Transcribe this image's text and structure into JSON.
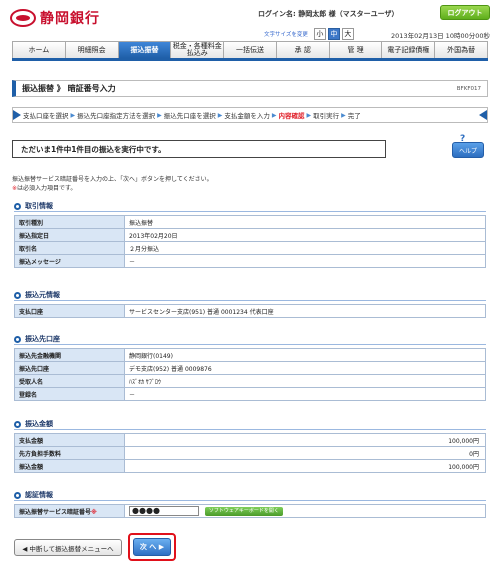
{
  "header": {
    "bank_name": "静岡銀行",
    "login_text": "ログイン名: 静岡太郎 様（マスターユーザ）",
    "logout_label": "ログアウト",
    "font_size_label": "文字サイズを変更",
    "font_sizes": [
      "小",
      "中",
      "大"
    ],
    "datetime": "2013年02月13日 10時00分00秒"
  },
  "nav": {
    "tabs": [
      {
        "label": "ホーム"
      },
      {
        "label": "明細照会"
      },
      {
        "label": "振込振替",
        "active": true
      },
      {
        "label": "税金・各種料金払込み"
      },
      {
        "label": "一括伝送"
      },
      {
        "label": "承 認"
      },
      {
        "label": "管 理"
      },
      {
        "label": "電子記録債権"
      },
      {
        "label": "外国為替"
      }
    ]
  },
  "page": {
    "title": "振込振替 》 暗証番号入力",
    "screen_code": "BFKF017"
  },
  "steps": {
    "items": [
      "支払口座を選択",
      "振込先口座指定方法を選択",
      "振込先口座を選択",
      "支払金額を入力",
      "内容確認",
      "取引実行",
      "完了"
    ],
    "current_index": 4
  },
  "notice": "ただいま1件中1件目の振込を実行中です。",
  "help_label": "ヘルプ",
  "instructions": {
    "line1": "振込振替サービス暗証番号を入力の上、「次へ」ボタンを押してください。",
    "line2_mark": "※",
    "line2": "は必須入力項目です。"
  },
  "sections": {
    "transaction": {
      "title": "取引情報",
      "rows": [
        {
          "label": "取引種別",
          "value": "振込振替"
        },
        {
          "label": "振込指定日",
          "value": "2013年02月20日"
        },
        {
          "label": "取引名",
          "value": "２月分振込"
        },
        {
          "label": "振込メッセージ",
          "value": "－"
        }
      ]
    },
    "source": {
      "title": "振込元情報",
      "rows": [
        {
          "label": "支払口座",
          "value": "サービスセンター支店(951) 普通 0001234 代表口座"
        }
      ]
    },
    "destination": {
      "title": "振込先口座",
      "rows": [
        {
          "label": "振込先金融機関",
          "value": "静岡銀行(0149)"
        },
        {
          "label": "振込先口座",
          "value": "デモ支店(952) 普通 0009876"
        },
        {
          "label": "受取人名",
          "value": "ﾊｽﾞｵｶ ｻﾌﾞﾛｳ"
        },
        {
          "label": "登録名",
          "value": "－"
        }
      ]
    },
    "amount": {
      "title": "振込金額",
      "rows": [
        {
          "label": "支払金額",
          "value": "100,000円"
        },
        {
          "label": "先方負担手数料",
          "value": "0円"
        },
        {
          "label": "振込金額",
          "value": "100,000円"
        }
      ]
    },
    "auth": {
      "title": "認証情報",
      "label": "振込振替サービス暗証番号",
      "required_mark": "※",
      "password_value": "●●●●",
      "soft_keyboard_label": "ソフトウェアキーボードを開く"
    }
  },
  "buttons": {
    "back": "◀ 中断して振込振替メニューへ",
    "next": "次 へ ▶"
  }
}
